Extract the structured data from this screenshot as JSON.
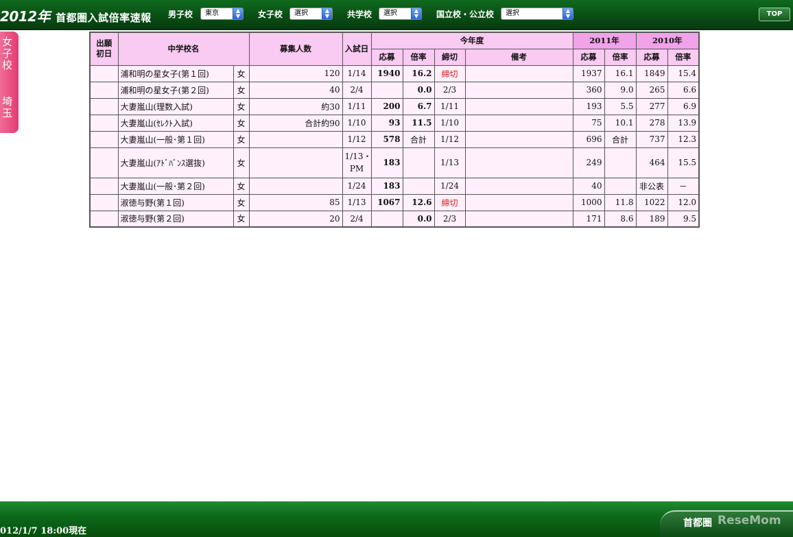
{
  "header": {
    "year": "2012年",
    "title": "首都圏入試倍率速報",
    "filters": [
      {
        "label": "男子校",
        "value": "東京"
      },
      {
        "label": "女子校",
        "value": "選択"
      },
      {
        "label": "共学校",
        "value": "選択"
      },
      {
        "label": "国立校・公立校",
        "value": "選択"
      }
    ],
    "top_button": "TOP"
  },
  "side_tab": {
    "line1": [
      "女",
      "子",
      "校"
    ],
    "line2": [
      "埼",
      "玉"
    ]
  },
  "table": {
    "headers": {
      "first_day": "出願\n初日",
      "school": "中学校名",
      "capacity": "募集人数",
      "exam_date": "入試日",
      "this_year": "今年度",
      "y2011": "2011年",
      "y2010": "2010年",
      "applicants": "応募",
      "ratio": "倍率",
      "deadline": "締切",
      "remarks": "備考"
    },
    "rows": [
      {
        "first": "",
        "school": "浦和明の星女子(第１回)",
        "type": "女",
        "cap": "120",
        "date": "1/14",
        "app": "1940",
        "ratio": "16.2",
        "dl": "締切",
        "dl_red": true,
        "note": "",
        "a11": "1937",
        "r11": "16.1",
        "a10": "1849",
        "r10": "15.4"
      },
      {
        "first": "",
        "school": "浦和明の星女子(第２回)",
        "type": "女",
        "cap": "40",
        "date": "2/4",
        "app": "",
        "ratio": "0.0",
        "dl": "2/3",
        "dl_red": false,
        "note": "",
        "a11": "360",
        "r11": "9.0",
        "a10": "265",
        "r10": "6.6"
      },
      {
        "first": "",
        "school": "大妻嵐山(理数入試)",
        "type": "女",
        "cap": "約30",
        "date": "1/11",
        "app": "200",
        "ratio": "6.7",
        "dl": "1/11",
        "dl_red": false,
        "note": "",
        "a11": "193",
        "r11": "5.5",
        "a10": "277",
        "r10": "6.9"
      },
      {
        "first": "",
        "school": "大妻嵐山(ｾﾚｸﾄ入試)",
        "type": "女",
        "cap": "合計約90",
        "date": "1/10",
        "app": "93",
        "ratio": "11.5",
        "dl": "1/10",
        "dl_red": false,
        "note": "",
        "a11": "75",
        "r11": "10.1",
        "a10": "278",
        "r10": "13.9"
      },
      {
        "first": "",
        "school": "大妻嵐山(一般･第１回)",
        "type": "女",
        "cap": "",
        "date": "1/12",
        "app": "578",
        "ratio": "合計",
        "dl": "1/12",
        "dl_red": false,
        "note": "",
        "a11": "696",
        "r11": "合計",
        "a10": "737",
        "r10": "12.3"
      },
      {
        "first": "",
        "school": "大妻嵐山(ｱﾄﾞﾊﾞﾝｽ選抜)",
        "type": "女",
        "cap": "",
        "date": "1/13・\nPM",
        "app": "183",
        "ratio": "",
        "dl": "1/13",
        "dl_red": false,
        "note": "",
        "a11": "249",
        "r11": "",
        "a10": "464",
        "r10": "15.5",
        "tall": true
      },
      {
        "first": "",
        "school": "大妻嵐山(一般･第２回)",
        "type": "女",
        "cap": "",
        "date": "1/24",
        "app": "183",
        "ratio": "",
        "dl": "1/24",
        "dl_red": false,
        "note": "",
        "a11": "40",
        "r11": "",
        "a10": "非公表",
        "r10": "－"
      },
      {
        "first": "",
        "school": "淑徳与野(第１回)",
        "type": "女",
        "cap": "85",
        "date": "1/13",
        "app": "1067",
        "ratio": "12.6",
        "dl": "締切",
        "dl_red": true,
        "note": "",
        "a11": "1000",
        "r11": "11.8",
        "a10": "1022",
        "r10": "12.0"
      },
      {
        "first": "",
        "school": "淑徳与野(第２回)",
        "type": "女",
        "cap": "20",
        "date": "2/4",
        "app": "",
        "ratio": "0.0",
        "dl": "2/3",
        "dl_red": false,
        "note": "",
        "a11": "171",
        "r11": "8.6",
        "a10": "189",
        "r10": "9.5"
      }
    ]
  },
  "footer": {
    "timestamp": "012/1/7 18:00現在",
    "brand": "首都圏",
    "watermark": "ReseMom"
  },
  "colors": {
    "header_green": "#0a4f15",
    "side_tab_pink": "#e23d72",
    "header_cell_pink": "#f9caf2",
    "row_pink": "#fff0fc",
    "deadline_red": "#e01a1a"
  }
}
